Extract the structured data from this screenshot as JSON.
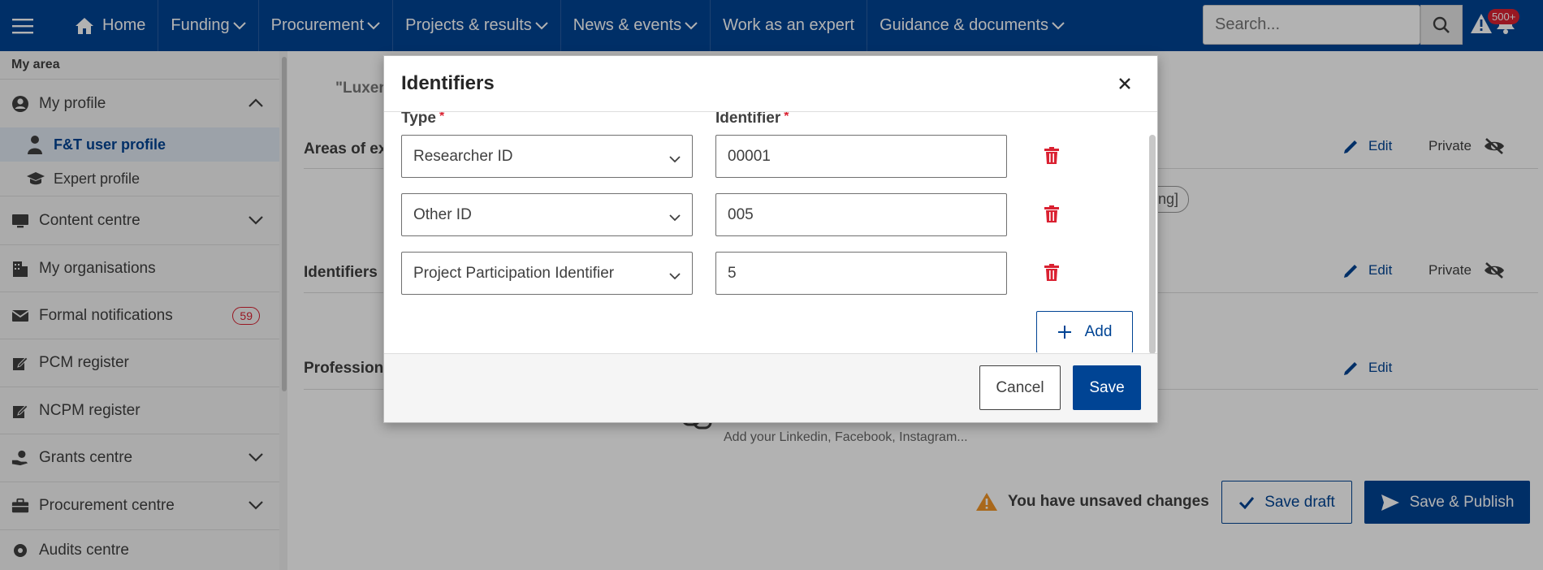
{
  "nav": {
    "items": [
      {
        "label": "Home",
        "icon": "home-icon"
      },
      {
        "label": "Funding",
        "dropdown": true
      },
      {
        "label": "Procurement",
        "dropdown": true
      },
      {
        "label": "Projects & results",
        "dropdown": true
      },
      {
        "label": "News & events",
        "dropdown": true
      },
      {
        "label": "Work as an expert",
        "dropdown": false
      },
      {
        "label": "Guidance & documents",
        "dropdown": true
      }
    ],
    "search_placeholder": "Search...",
    "notification_badge": "500+"
  },
  "sidebar": {
    "title": "My area",
    "items": [
      {
        "label": "My profile",
        "icon": "user-circle-icon",
        "expanded": true
      },
      {
        "label": "F&T user profile",
        "icon": "person-icon",
        "sub": true,
        "active": true
      },
      {
        "label": "Expert profile",
        "icon": "graduation-cap-icon",
        "sub": true
      },
      {
        "label": "Content centre",
        "icon": "monitor-icon",
        "chevron": true
      },
      {
        "label": "My organisations",
        "icon": "building-icon"
      },
      {
        "label": "Formal notifications",
        "icon": "envelope-icon",
        "badge": "59"
      },
      {
        "label": "PCM register",
        "icon": "edit-icon"
      },
      {
        "label": "NCPM register",
        "icon": "edit-icon"
      },
      {
        "label": "Grants centre",
        "icon": "hand-coin-icon",
        "chevron": true
      },
      {
        "label": "Procurement centre",
        "icon": "briefcase-icon",
        "chevron": true
      },
      {
        "label": "Audits centre",
        "icon": "gear-icon"
      }
    ]
  },
  "main": {
    "quote_text": "\"Luxer",
    "sections": {
      "areas": {
        "title": "Areas of ex",
        "edit": "Edit",
        "privacy": "Private",
        "chip": "ring]"
      },
      "identifiers": {
        "title": "Identifiers",
        "edit": "Edit",
        "privacy": "Private"
      },
      "professional": {
        "title": "Profession",
        "edit": "Edit",
        "links_hint": "Add your Linkedin, Facebook, Instagram..."
      }
    },
    "unsaved_text": "You have unsaved changes",
    "save_draft": "Save draft",
    "save_publish": "Save & Publish"
  },
  "modal": {
    "title": "Identifiers",
    "col_type": "Type",
    "col_identifier": "Identifier",
    "required_mark": "*",
    "rows": [
      {
        "type": "Researcher ID",
        "identifier": "00001"
      },
      {
        "type": "Other ID",
        "identifier": "005"
      },
      {
        "type": "Project Participation Identifier",
        "identifier": "5"
      }
    ],
    "add_label": "Add",
    "cancel_label": "Cancel",
    "save_label": "Save"
  },
  "colors": {
    "primary": "#004494",
    "danger": "#da2131",
    "warning": "#f29527"
  }
}
